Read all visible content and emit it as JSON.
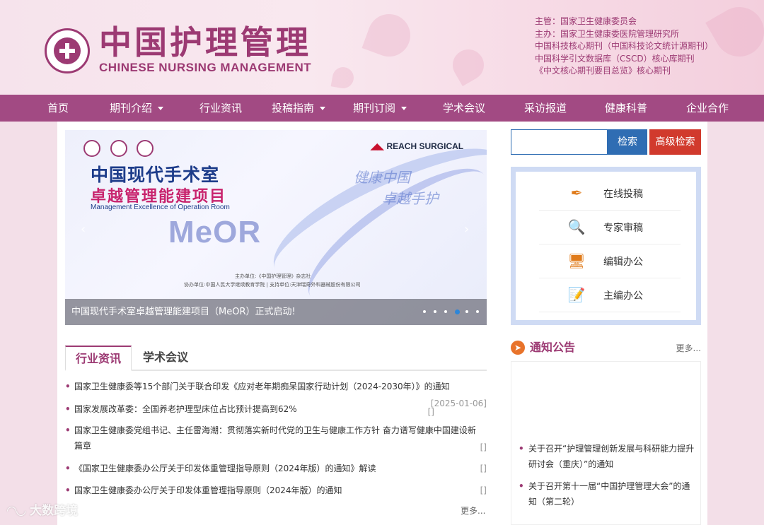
{
  "header": {
    "title_cn": "中国护理管理",
    "title_en": "CHINESE NURSING MANAGEMENT",
    "credits": [
      "主管：国家卫生健康委员会",
      "主办：国家卫生健康委医院管理研究所",
      "中国科技核心期刊（中国科技论文统计源期刊）",
      "中国科学引文数据库（CSCD）核心库期刊",
      "《中文核心期刊要目总览》核心期刊"
    ]
  },
  "nav": {
    "items": [
      {
        "label": "首页",
        "dropdown": false
      },
      {
        "label": "期刊介绍",
        "dropdown": true
      },
      {
        "label": "行业资讯",
        "dropdown": false
      },
      {
        "label": "投稿指南",
        "dropdown": true
      },
      {
        "label": "期刊订阅",
        "dropdown": true
      },
      {
        "label": "学术会议",
        "dropdown": false
      },
      {
        "label": "采访报道",
        "dropdown": false
      },
      {
        "label": "健康科普",
        "dropdown": false
      },
      {
        "label": "企业合作",
        "dropdown": false
      }
    ]
  },
  "banner": {
    "sponsor": "REACH SURGICAL",
    "title_line1": "中国现代手术室",
    "title_line2": "卓越管理能建项目",
    "title_en": "Management Excellence of Operation Room",
    "slogan_line1": "健康中国",
    "slogan_line2": "卓越手护",
    "program": "MeOR",
    "host": "主办单位:《中国护理管理》杂志社",
    "support": "协办单位:中国人民大学继续教育学院 | 支持单位:天津瑞奇外科器械股份有限公司",
    "caption": "中国现代手术室卓越管理能建项目（MeOR）正式启动!",
    "slide_count": 6,
    "active_slide": 4
  },
  "search": {
    "placeholder": "",
    "button": "检索",
    "advanced": "高级检索"
  },
  "quick_links": [
    {
      "label": "在线投稿",
      "icon": "quill-pen-icon",
      "glyph": "✒"
    },
    {
      "label": "专家审稿",
      "icon": "magnifier-icon",
      "glyph": "🔍"
    },
    {
      "label": "编辑办公",
      "icon": "monitor-network-icon",
      "glyph": "🖥"
    },
    {
      "label": "主编办公",
      "icon": "document-pen-icon",
      "glyph": "📝"
    }
  ],
  "tabs": [
    {
      "label": "行业资讯",
      "active": true
    },
    {
      "label": "学术会议",
      "active": false
    }
  ],
  "news": [
    {
      "text": "国家卫生健康委等15个部门关于联合印发《应对老年期痴呆国家行动计划（2024-2030年）》的通知",
      "date": ""
    },
    {
      "text": "国家发展改革委：全国养老护理型床位占比预计提高到62%",
      "date": "[2025-01-06]"
    },
    {
      "text": "国家卫生健康委党组书记、主任雷海潮：贯彻落实新时代党的卫生与健康工作方针 奋力谱写健康中国建设新篇章",
      "date": "[]"
    },
    {
      "text": "《国家卫生健康委办公厅关于印发体重管理指导原则（2024年版）的通知》解读",
      "date": "[]"
    },
    {
      "text": "国家卫生健康委办公厅关于印发体重管理指导原则（2024年版）的通知",
      "date": "[]"
    }
  ],
  "news_more": "更多...",
  "notice": {
    "title": "通知公告",
    "more": "更多...",
    "items": [
      "关于召开“护理管理创新发展与科研能力提升研讨会（重庆）”的通知",
      "关于召开第十一届“中国护理管理大会”的通知（第二轮）"
    ]
  },
  "watermark": "大数跨境",
  "colors": {
    "brand": "#9c3a73",
    "nav": "#a24a83",
    "search_blue": "#2f6db3",
    "advanced_red": "#d13a2d"
  }
}
